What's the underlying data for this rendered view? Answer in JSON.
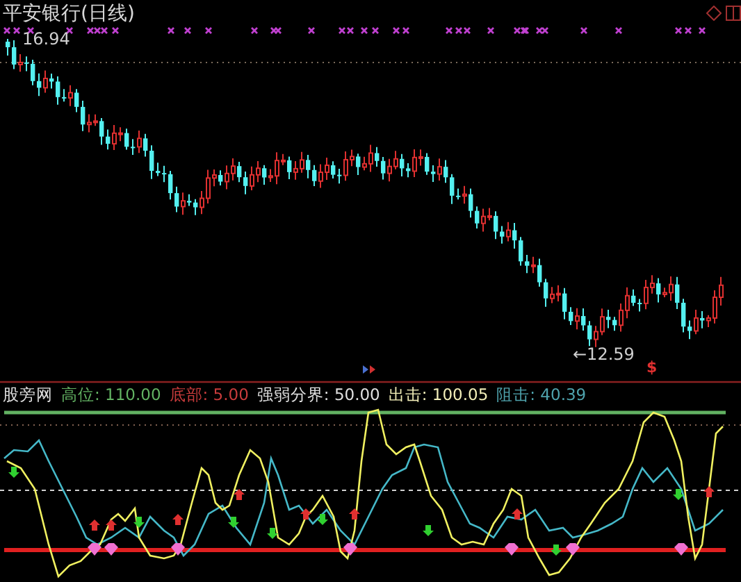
{
  "chart": {
    "title": "平安银行(日线)",
    "high_label": "16.94",
    "low_label": "←12.59",
    "signal_mark": "$"
  },
  "indicator": {
    "name": "股旁网",
    "legend": [
      {
        "text": "高位: 110.00",
        "color": "#62b262"
      },
      {
        "text": "底部: 5.00",
        "color": "#c83c3c"
      },
      {
        "text": "强弱分界: 50.00",
        "color": "#e0e0e0"
      },
      {
        "text": "出击: 100.05",
        "color": "#f2eeb8"
      },
      {
        "text": "阻击: 40.39",
        "color": "#4fa3ad"
      }
    ]
  }
}
